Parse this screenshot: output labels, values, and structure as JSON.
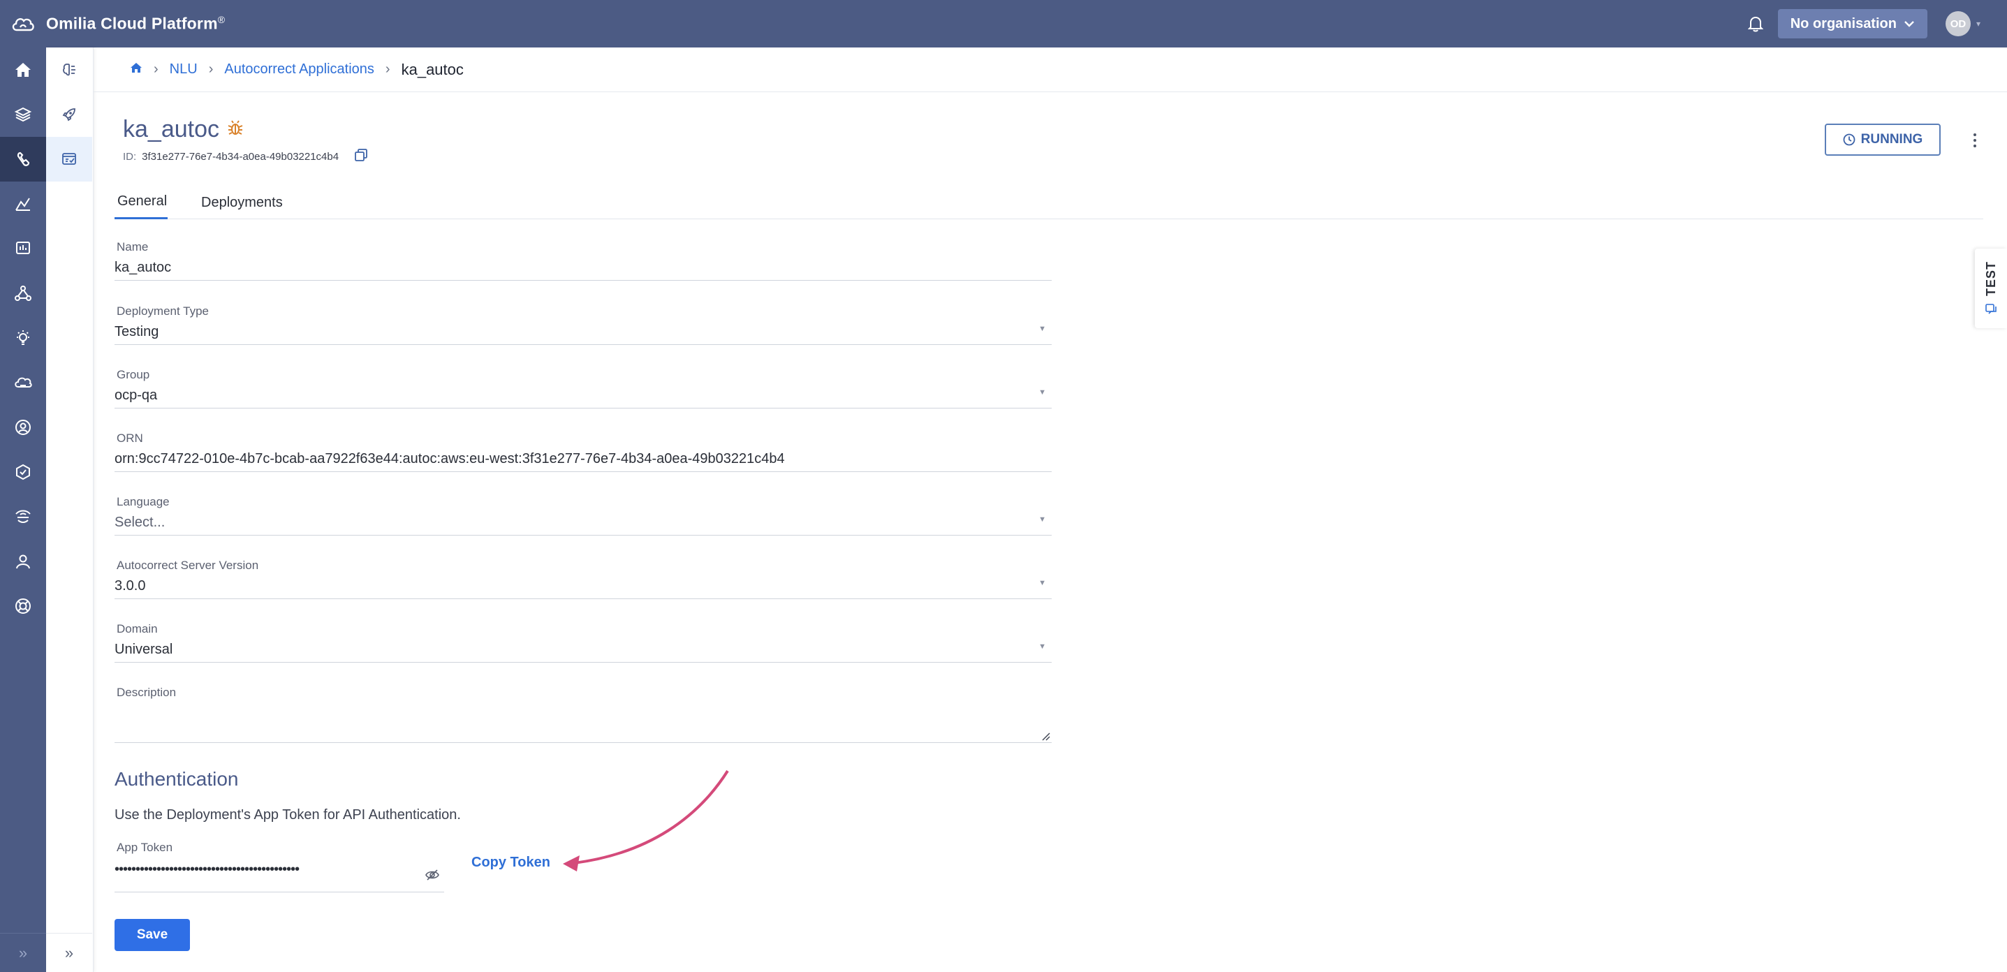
{
  "topbar": {
    "brand": "Omilia Cloud Platform",
    "brand_reg": "®",
    "org_label": "No organisation",
    "avatar_initials": "OD"
  },
  "rail": {
    "items": [
      "home-icon",
      "layers-icon",
      "nlu-icon",
      "analytics-icon",
      "monitor-icon",
      "graph-icon",
      "idea-icon",
      "cloud-icon",
      "team-icon",
      "shield-icon",
      "biometrics-icon",
      "user-icon",
      "support-icon"
    ],
    "active_index": 2
  },
  "subrail": {
    "items": [
      "ai-icon",
      "rocket-icon",
      "autocorrect-icon"
    ],
    "active_index": 2
  },
  "breadcrumb": {
    "items": [
      "NLU",
      "Autocorrect Applications"
    ],
    "current": "ka_autoc"
  },
  "app": {
    "title": "ka_autoc",
    "id_label": "ID:",
    "id_value": "3f31e277-76e7-4b34-a0ea-49b03221c4b4",
    "status": "RUNNING"
  },
  "tabs": [
    {
      "label": "General",
      "active": true
    },
    {
      "label": "Deployments",
      "active": false
    }
  ],
  "form": {
    "name": {
      "label": "Name",
      "value": "ka_autoc"
    },
    "deployment_type": {
      "label": "Deployment Type",
      "value": "Testing"
    },
    "group": {
      "label": "Group",
      "value": "ocp-qa"
    },
    "orn": {
      "label": "ORN",
      "value": "orn:9cc74722-010e-4b7c-bcab-aa7922f63e44:autoc:aws:eu-west:3f31e277-76e7-4b34-a0ea-49b03221c4b4"
    },
    "language": {
      "label": "Language",
      "placeholder": "Select..."
    },
    "server_version": {
      "label": "Autocorrect Server Version",
      "value": "3.0.0"
    },
    "domain": {
      "label": "Domain",
      "value": "Universal"
    },
    "description": {
      "label": "Description",
      "value": ""
    }
  },
  "auth": {
    "title": "Authentication",
    "description": "Use the Deployment's App Token for API Authentication.",
    "token_label": "App Token",
    "token_value": "••••••••••••••••••••••••••••••••••••••••••••",
    "copy_label": "Copy Token"
  },
  "save_label": "Save",
  "test_tab_label": "TEST",
  "colors": {
    "topbar": "#4c5b84",
    "accent": "#2f6fd6",
    "annotation_arrow": "#d44a7a"
  }
}
